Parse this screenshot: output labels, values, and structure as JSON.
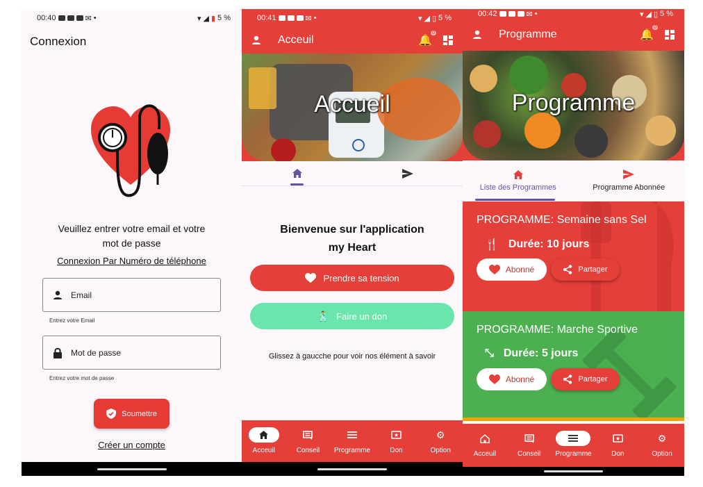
{
  "login": {
    "status_time": "00:40",
    "status_battery": "5 %",
    "title": "Connexion",
    "intro_line1": "Veuillez entrer votre email et votre",
    "intro_line2": "mot de passe",
    "phone_link": "Connexion Par Numéro de téléphone",
    "email_placeholder": "Email",
    "email_hint": "Entrez votre Email",
    "password_placeholder": "Mot de passe",
    "password_hint": "Entrez votre mot de passe",
    "submit_label": "Soumettre",
    "create_account": "Créer un compte"
  },
  "home": {
    "status_time": "00:41",
    "status_battery": "5 %",
    "appbar_title": "Acceuil",
    "notif_count": "0",
    "hero_title": "Accueil",
    "welcome_line1": "Bienvenue sur l'application",
    "welcome_line2": "my Heart",
    "btn_tension": "Prendre sa tension",
    "btn_don": "Faire un don",
    "swipe_text": "Glissez à gaucche pour voir nos élément à savoir"
  },
  "programme": {
    "status_time": "00:42",
    "status_battery": "5 %",
    "appbar_title": "Programme",
    "notif_count": "0",
    "hero_title": "Programme",
    "tab_list": "Liste des Programmes",
    "tab_subscribed": "Programme Abonnée",
    "cards": [
      {
        "title": "PROGRAMME: Semaine sans Sel",
        "duration": "Durée: 10 jours",
        "subscribed": "Abonné",
        "share": "Partager"
      },
      {
        "title": "PROGRAMME: Marche Sportive",
        "duration": "Durée: 5 jours",
        "subscribed": "Abonné",
        "share": "Partager"
      }
    ]
  },
  "bottom_nav": {
    "accueil": "Acceuil",
    "conseil": "Conseil",
    "programme": "Programme",
    "don": "Don",
    "option": "Option"
  },
  "colors": {
    "red": "#e53f3a",
    "green": "#4caf50",
    "mint": "#6ae6ad",
    "purple": "#6750a4"
  }
}
